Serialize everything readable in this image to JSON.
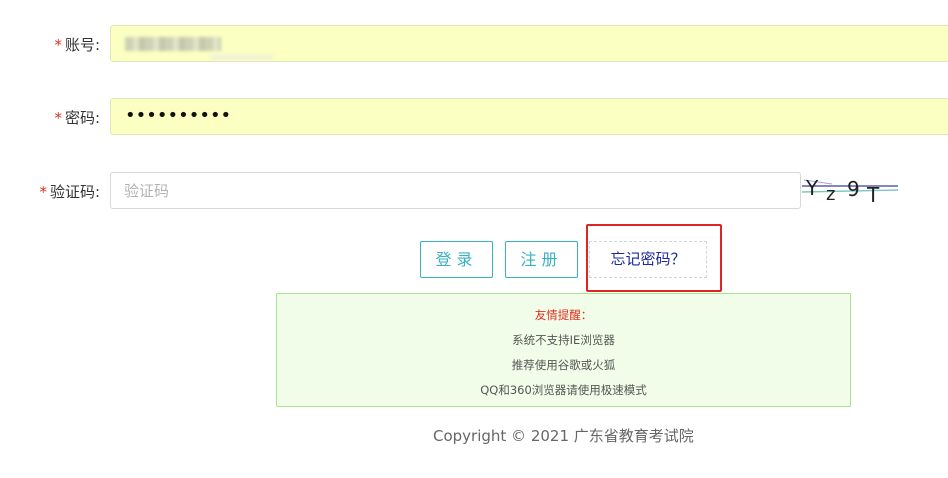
{
  "form": {
    "account": {
      "required_mark": "*",
      "label": "账号:"
    },
    "password": {
      "required_mark": "*",
      "label": "密码:",
      "value_masked": "••••••••••"
    },
    "captcha": {
      "required_mark": "*",
      "label": "验证码:",
      "placeholder": "验证码",
      "image_text": "Yz9T"
    }
  },
  "buttons": {
    "login": "登录",
    "register": "注册",
    "forgot": "忘记密码？"
  },
  "notice": {
    "title": "友情提醒：",
    "lines": [
      "系统不支持IE浏览器",
      "推荐使用谷歌或火狐",
      "QQ和360浏览器请使用极速模式"
    ]
  },
  "footer": {
    "copyright": "Copyright © 2021 广东省教育考试院"
  },
  "colors": {
    "accent": "#3ab1c1",
    "required": "#e0301e",
    "highlight": "#e02424",
    "autofill": "#fbffc2",
    "notice_bg": "#f1fde9"
  }
}
